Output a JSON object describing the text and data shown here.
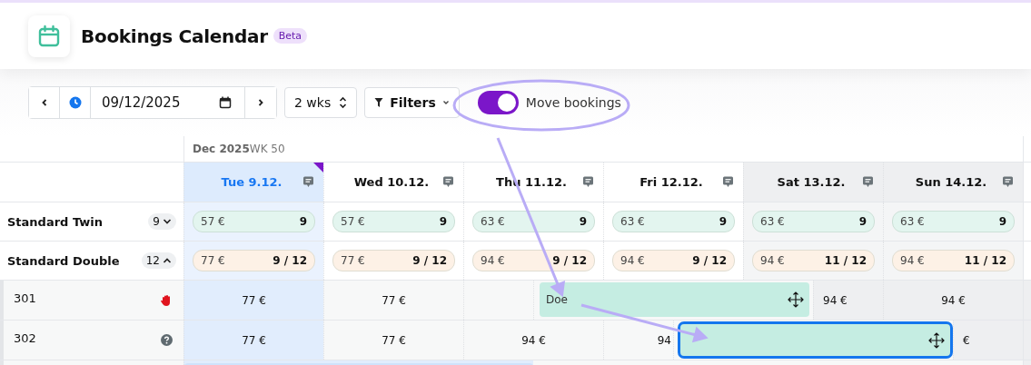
{
  "header": {
    "title": "Bookings Calendar",
    "badge": "Beta"
  },
  "toolbar": {
    "date": "09/12/2025",
    "range": "2 wks",
    "filters": "Filters",
    "move_toggle": {
      "label": "Move bookings",
      "on": true
    }
  },
  "calendar": {
    "month": "Dec 2025",
    "week": "WK 50",
    "days": [
      {
        "label": "Tue 9.12.",
        "today": true,
        "weekend": false,
        "flagged": true
      },
      {
        "label": "Wed 10.12.",
        "today": false,
        "weekend": false,
        "flagged": false
      },
      {
        "label": "Thu 11.12.",
        "today": false,
        "weekend": false,
        "flagged": false
      },
      {
        "label": "Fri 12.12.",
        "today": false,
        "weekend": false,
        "flagged": false
      },
      {
        "label": "Sat 13.12.",
        "today": false,
        "weekend": true,
        "flagged": false
      },
      {
        "label": "Sun 14.12.",
        "today": false,
        "weekend": true,
        "flagged": false
      }
    ],
    "room_types": [
      {
        "name": "Standard Twin",
        "count": "9",
        "expanded": false,
        "color": "#e3f5ef",
        "cells": [
          {
            "price": "57 €",
            "availability": "9"
          },
          {
            "price": "57 €",
            "availability": "9"
          },
          {
            "price": "63 €",
            "availability": "9"
          },
          {
            "price": "63 €",
            "availability": "9"
          },
          {
            "price": "63 €",
            "availability": "9"
          },
          {
            "price": "63 €",
            "availability": "9"
          }
        ]
      },
      {
        "name": "Standard Double",
        "count": "12",
        "expanded": true,
        "color": "#fdf1e6",
        "cells": [
          {
            "price": "77 €",
            "availability": "9 / 12"
          },
          {
            "price": "77 €",
            "availability": "9 / 12"
          },
          {
            "price": "94 €",
            "availability": "9 / 12"
          },
          {
            "price": "94 €",
            "availability": "9 / 12"
          },
          {
            "price": "94 €",
            "availability": "11 / 12"
          },
          {
            "price": "94 €",
            "availability": "11 / 12"
          }
        ]
      }
    ],
    "rooms": [
      {
        "name": "301",
        "kind": "blocked",
        "slots": [
          {
            "kind": "price",
            "text": "77 €"
          },
          {
            "kind": "price",
            "text": "77 €"
          },
          {
            "kind": "empty"
          },
          {
            "kind": "booking",
            "guest": "Doe"
          },
          {
            "kind": "price",
            "text": "94 €"
          },
          {
            "kind": "price",
            "text": "94 €"
          }
        ]
      },
      {
        "name": "302",
        "kind": "unknown",
        "slots": [
          {
            "kind": "price",
            "text": "77 €"
          },
          {
            "kind": "price",
            "text": "77 €"
          },
          {
            "kind": "price",
            "text": "94 €"
          },
          {
            "kind": "price",
            "text": "94"
          },
          {
            "kind": "drop_target"
          },
          {
            "kind": "price",
            "text": "€"
          }
        ]
      },
      {
        "slots": [
          {
            "kind": "booking"
          }
        ]
      }
    ]
  },
  "annotations": [
    {
      "kind": "ellipse"
    },
    {
      "kind": "arrow"
    },
    {
      "kind": "arrow"
    }
  ]
}
